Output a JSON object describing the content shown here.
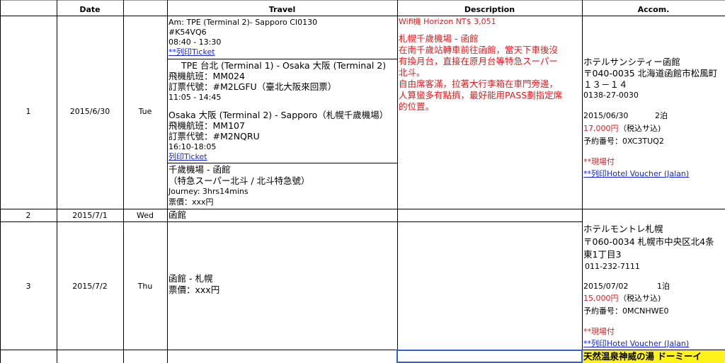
{
  "headers": {
    "date": "Date",
    "travel": "Travel",
    "description": "Description",
    "accom": "Accom."
  },
  "rows": [
    {
      "num": "1",
      "date": "2015/6/30",
      "day": "Tue"
    },
    {
      "num": "2",
      "date": "2015/7/1",
      "day": "Wed"
    },
    {
      "num": "3",
      "date": "2015/7/2",
      "day": "Thu"
    }
  ],
  "travel": {
    "block1": {
      "line1": "Am: TPE (Terminal 2)- Sapporo CI0130",
      "line2": "#K54VQ6",
      "line3": "08:40 - 13:30",
      "link": "**列印Ticket"
    },
    "block2": {
      "line1": "TPE 台北 (Terminal 1) - Osaka 大阪 (Terminal 2)",
      "line2": "飛機航班：MM024",
      "line3": "訂票代號：#M2LGFU（臺北大阪來回票）",
      "line4": "11:05 - 14:45",
      "line5": "Osaka 大阪 (Terminal 2) - Sapporo（札幌千歲機場）",
      "line6": "飛機航班：MM107",
      "line7": "訂票代號：#M2NQRU",
      "line8": "16:10-18:05",
      "link": "列印Ticket"
    },
    "block3": {
      "line1": "千歲機場 - 函館",
      "line2": "（特急スーパー北斗 / 北斗特急號）",
      "line3": "Journey: 3hrs14mins",
      "line4": "票價：xxx円"
    },
    "row2": "函館",
    "row3_line1": "函館 - 札幌",
    "row3_line2": "票價：xxx円"
  },
  "description": {
    "wifi": "Wifi機 Horizon NT$ 3,051",
    "lines": [
      "札幌千歲機場 - 函館",
      "在南千歲站轉車前往函館，當天下車後沒",
      "有換月台，直接在原月台等特急スーパー",
      "北斗。",
      "自由席客滿，拉著大行李箱在車門旁邊，",
      "人算蠻多有點擠，最好能用PASS劃指定席",
      "的位置。"
    ]
  },
  "accom": {
    "hotel1": {
      "name": "ホテルサンシティー函館",
      "address": "〒040-0035 北海道函館市松風町",
      "address2": "１３－１４",
      "phone": "0138-27-0030",
      "stay": "2015/06/30",
      "nights": "2泊",
      "price": "17,000円",
      "tax": "（税込サ込)",
      "reservation": "予約番号：0XC3TUQ2",
      "payment": "**現場付",
      "voucher": "**列印Hotel Voucher (Jalan)"
    },
    "hotel2": {
      "name": "ホテルモントレ札幌",
      "address": "〒060-0034 札幌市中央区北4条",
      "address2": "東1丁目3",
      "phone": "011-232-7111",
      "stay": "2015/07/02",
      "nights": "1泊",
      "price": "15,000円",
      "tax": "（税込サ込)",
      "reservation": "予約番号：0MCNHWE0",
      "payment": "**現場付",
      "voucher": "**列印Hotel Voucher (Jalan)"
    },
    "hotel3": {
      "name": "天然温泉神威の湯 ドーミーイ"
    }
  },
  "colors": {
    "red": "#e01b1b",
    "link": "#1428d0",
    "highlight": "#fff21a",
    "selection": "#2b63d6"
  }
}
